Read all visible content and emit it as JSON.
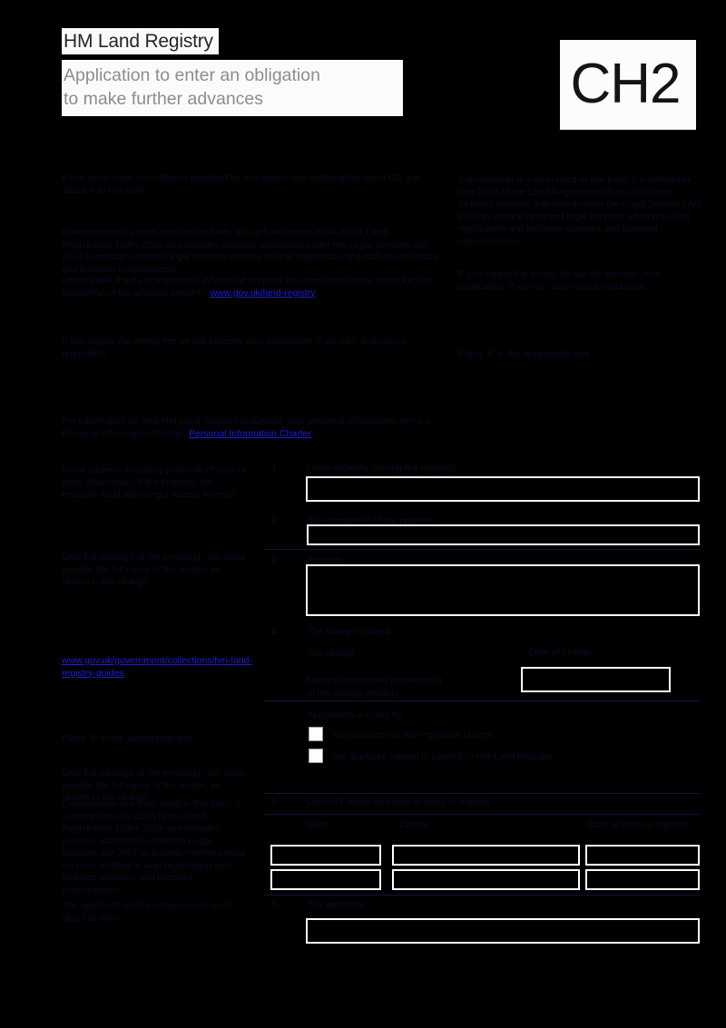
{
  "header": {
    "brand": "HM Land Registry",
    "title_line1": "Application to enter an obligation",
    "title_line2": "to make further advances",
    "form_code": "CH2"
  },
  "notes_top": {
    "line1": "If you need more room than is provided for in a panel, use continuation sheet CS and attach it to this form.",
    "line2": "Leave blank if not yet registered. Where the property has been registered, insert the title number(s) of the affected property.",
    "line3": "For information on how HM Land Registry processes your personal information, see our Personal Information Charter.",
    "url_land_registry": "www.gov.uk/land-registry",
    "link_charter": "Personal Information Charter"
  },
  "right_notes": {
    "note1": "Conveyancer is a term used in this form. It is defined in rule 217A of the Land Registration Rules 2003 and includes persons authorised under the Legal Services Act 2007 to provide reserved legal services relating to land registration and includes solicitors and licensed conveyancers.",
    "note2": "If you supply the wrong fee we will process your application, if we can, and raise a requisition.",
    "note3": "Place 'X' in the appropriate box."
  },
  "left_notes": {
    "note_1": "Insert address including postcode (if any) or other description of the property, for example 'land adjoining 2 Acacia Avenue'.",
    "note_2": "Give full name(s) of the lender(s). You must provide the full name of the lender, as shown in the charge.",
    "note_3": "Place 'X' in the appropriate box.",
    "note_4": "The applicant or their conveyancer must sign this form.",
    "guides_url": "www.gov.uk/government/collections/hm-land-registry-guides"
  },
  "form": {
    "rows": [
      {
        "num": "1",
        "label": "Local authority serving the property"
      },
      {
        "num": "2",
        "label": "Title number(s) of the property"
      },
      {
        "num": "3",
        "label": "Property"
      },
      {
        "num": "4",
        "label": "The charge or deed"
      }
    ],
    "charge": {
      "line_charge": "The charge",
      "date_label": "Date of charge",
      "proprietor_line1": "Name of registered proprietor(s)",
      "proprietor_line2": "of the charge (lender)",
      "apply_label": "Application is made by",
      "option1": "the proprietor of the registered charge",
      "option2": "the applicant named in panel 5 of HM Land Registry"
    },
    "table": {
      "section_num": "5",
      "section_label": "Date of Charge and date of entry in register",
      "headers": [
        "Date",
        "Lender",
        "Date of entry in register"
      ],
      "rows": [
        {
          "date": "",
          "lender": "",
          "entry": ""
        },
        {
          "date": "",
          "lender": "",
          "entry": ""
        }
      ]
    },
    "applicant": {
      "num": "5",
      "label": "The applicant",
      "value": ""
    }
  },
  "colors": {
    "accent_link": "#1d1dd8",
    "panel_white": "#ffffff",
    "background": "#000000"
  }
}
